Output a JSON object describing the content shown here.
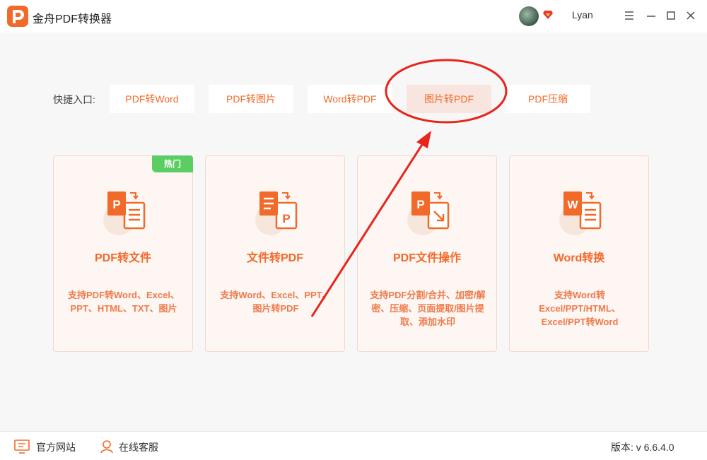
{
  "app": {
    "title": "金舟PDF转换器",
    "accent": "#f26a2a"
  },
  "user": {
    "name": "Lyan"
  },
  "quick_entry": {
    "label": "快捷入口:",
    "items": [
      {
        "label": "PDF转Word"
      },
      {
        "label": "PDF转图片"
      },
      {
        "label": "Word转PDF"
      },
      {
        "label": "图片转PDF",
        "active": true
      },
      {
        "label": "PDF压缩"
      }
    ]
  },
  "cards": [
    {
      "title": "PDF转文件",
      "badge": "热门",
      "desc": "支持PDF转Word、Excel、PPT、HTML、TXT、图片",
      "icon": "pdf-to-file-icon"
    },
    {
      "title": "文件转PDF",
      "desc": "支持Word、Excel、PPT、图片转PDF",
      "icon": "file-to-pdf-icon"
    },
    {
      "title": "PDF文件操作",
      "desc": "支持PDF分割/合并、加密/解密、压缩、页面提取/图片提取、添加水印",
      "icon": "pdf-operation-icon"
    },
    {
      "title": "Word转换",
      "desc": "支持Word转Excel/PPT/HTML、Excel/PPT转Word",
      "icon": "word-convert-icon"
    }
  ],
  "footer": {
    "website": "官方网站",
    "service": "在线客服",
    "version": "版本:  v 6.6.4.0"
  }
}
